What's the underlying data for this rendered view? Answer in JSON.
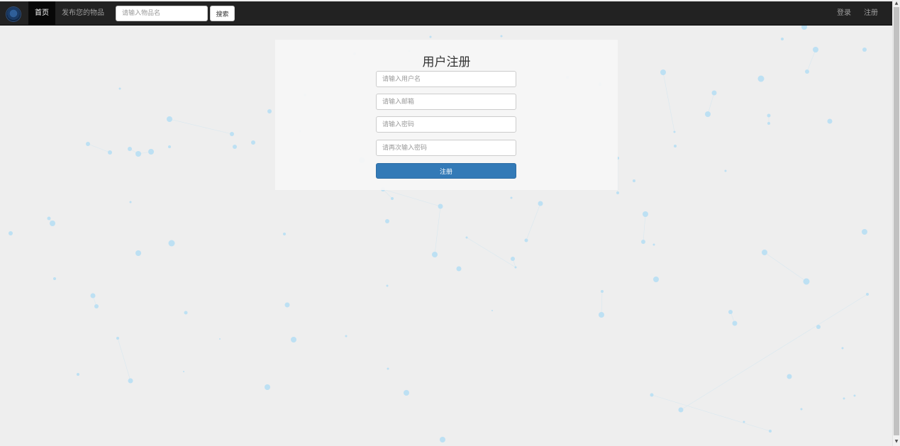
{
  "navbar": {
    "logo_icon": "school-emblem-icon",
    "home_label": "首页",
    "publish_label": "发布您的物品",
    "search_placeholder": "请输入物品名",
    "search_button_label": "搜索",
    "login_label": "登录",
    "register_label": "注册"
  },
  "register_form": {
    "title": "用户注册",
    "username_placeholder": "请输入用户名",
    "email_placeholder": "请输入邮箱",
    "password_placeholder": "请输入密码",
    "confirm_password_placeholder": "请再次输入密码",
    "submit_label": "注册"
  },
  "colors": {
    "navbar_bg": "#222222",
    "page_bg": "#eeeeee",
    "particle": "#bde0f3",
    "primary_button": "#337ab7"
  }
}
